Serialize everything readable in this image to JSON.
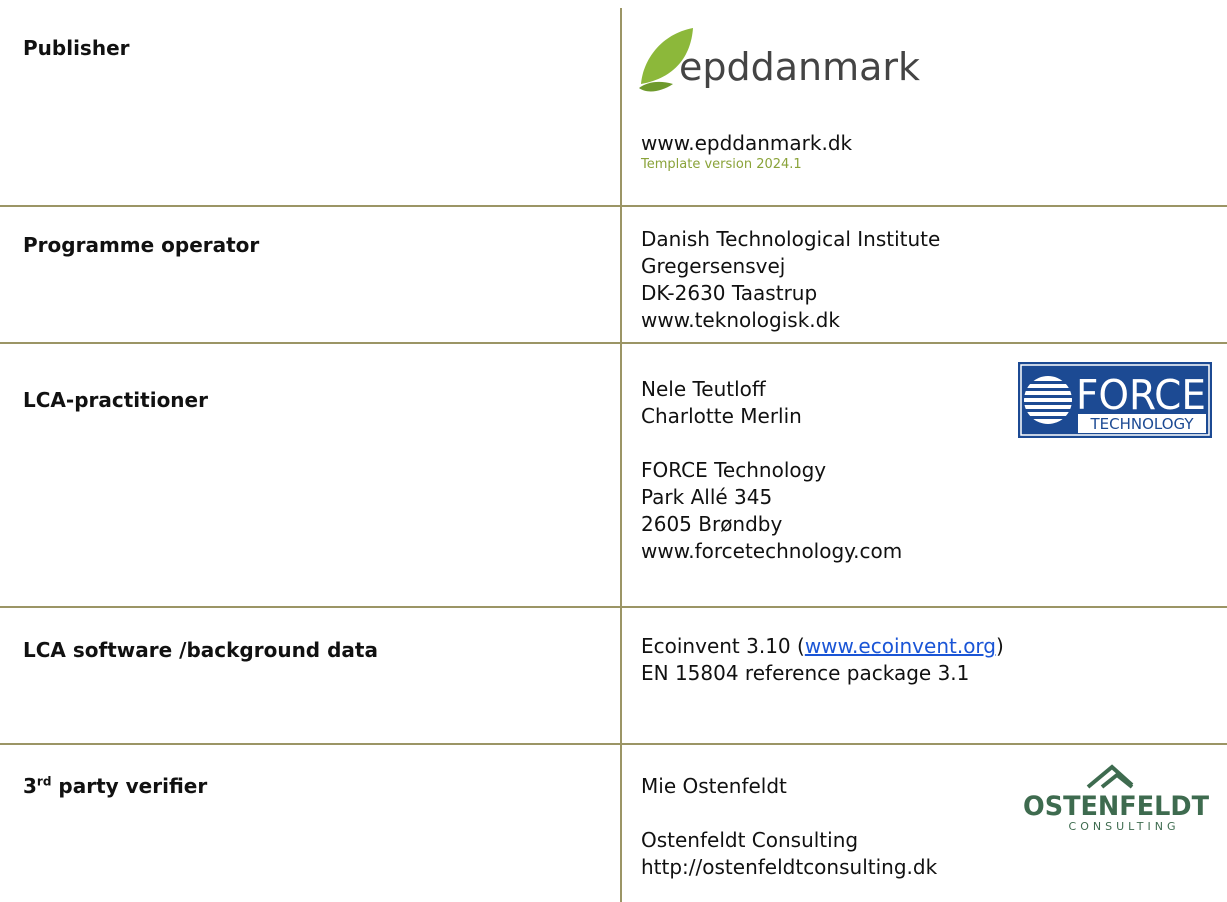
{
  "rows": [
    {
      "label": "Publisher",
      "logo": {
        "name": "epddanmark-logo",
        "text": "epddanmark",
        "leaf_color": "#8cb83a",
        "text_color": "#444444"
      },
      "lines": [
        "www.epddanmark.dk"
      ],
      "template_version": "Template version 2024.1"
    },
    {
      "label": "Programme operator",
      "lines": [
        "Danish Technological Institute",
        "Gregersensvej",
        "DK-2630 Taastrup",
        "www.teknologisk.dk"
      ]
    },
    {
      "label": "LCA-practitioner",
      "logo": {
        "name": "force-technology-logo",
        "top_text": "FORCE",
        "bottom_text": "TECHNOLOGY",
        "color": "#1c4a93"
      },
      "lines_a": [
        "Nele Teutloff",
        "Charlotte Merlin"
      ],
      "lines_b": [
        "FORCE Technology",
        "Park Allé 345",
        "2605 Brøndby",
        "www.forcetechnology.com"
      ]
    },
    {
      "label": "LCA software /background data",
      "line1_prefix": "Ecoinvent 3.10 (",
      "line1_link": "www.ecoinvent.org",
      "line1_suffix": ")",
      "line2": "EN 15804 reference package 3.1"
    },
    {
      "label_main": "3",
      "label_sup": "rd",
      "label_rest": " party verifier",
      "logo": {
        "name": "ostenfeldt-logo",
        "text": "OSTENFELDT",
        "sub_text": "CONSULTING",
        "color": "#3e6b4f"
      },
      "lines_a": [
        "Mie Ostenfeldt"
      ],
      "lines_b": [
        "Ostenfeldt Consulting",
        "http://ostenfeldtconsulting.dk"
      ]
    }
  ]
}
